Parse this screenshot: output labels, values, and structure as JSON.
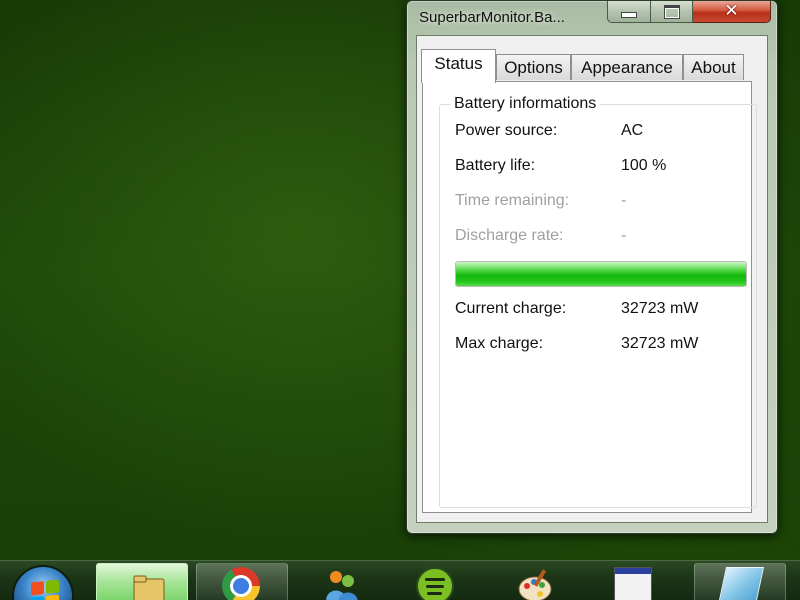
{
  "window": {
    "title": "SuperbarMonitor.Ba..."
  },
  "tabs": [
    {
      "label": "Status",
      "active": true
    },
    {
      "label": "Options",
      "active": false
    },
    {
      "label": "Appearance",
      "active": false
    },
    {
      "label": "About",
      "active": false
    }
  ],
  "battery": {
    "group_title": "Battery informations",
    "power_source_label": "Power source:",
    "power_source_value": "AC",
    "battery_life_label": "Battery life:",
    "battery_life_value": "100 %",
    "time_remaining_label": "Time remaining:",
    "time_remaining_value": "-",
    "discharge_rate_label": "Discharge rate:",
    "discharge_rate_value": "-",
    "charge_level_percent": 100,
    "current_charge_label": "Current charge:",
    "current_charge_value": "32723 mW",
    "max_charge_label": "Max charge:",
    "max_charge_value": "32723 mW"
  },
  "taskbar": {
    "items": [
      {
        "icon": "windows-logo-icon"
      },
      {
        "icon": "windows-explorer-icon"
      },
      {
        "icon": "chrome-icon"
      },
      {
        "icon": "messenger-icon"
      },
      {
        "icon": "spotify-icon"
      },
      {
        "icon": "paint-icon"
      },
      {
        "icon": "application-window-icon"
      },
      {
        "icon": "aero-glass-icon"
      }
    ]
  },
  "colors": {
    "desktop_background": "#1d4708",
    "progress_fill": "#16b80f",
    "close_button": "#c9482e",
    "dimmed_text": "#a0a0a0"
  }
}
